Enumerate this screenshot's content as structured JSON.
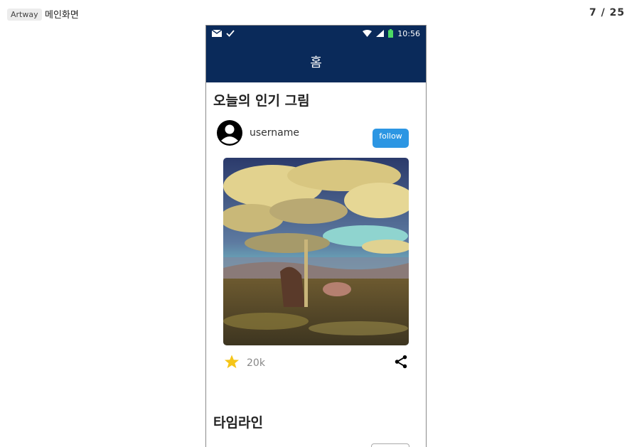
{
  "header": {
    "app_tag": "Artway",
    "page_title": "메인화면",
    "counter": "7 / 25"
  },
  "statusbar": {
    "time": "10:56",
    "icons": [
      "mail-icon",
      "check-icon",
      "wifi-icon",
      "signal-icon",
      "battery-icon"
    ]
  },
  "appbar": {
    "title": "홈"
  },
  "popular": {
    "title": "오늘의 인기 그림",
    "username": "username",
    "follow_label": "follow",
    "likes": "20k"
  },
  "timeline": {
    "title": "타임라인"
  },
  "colors": {
    "navy": "#0a2a5a",
    "follow_blue": "#2c96e3",
    "star_yellow": "#f5c518"
  }
}
